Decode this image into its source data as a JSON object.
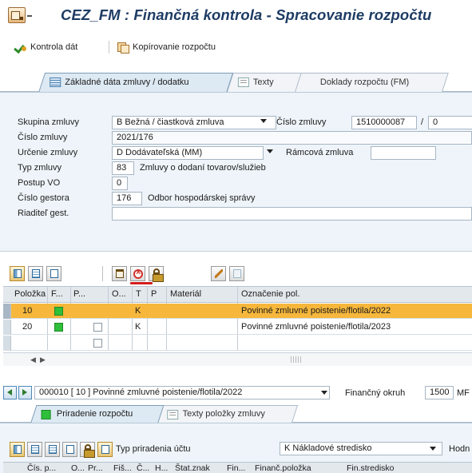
{
  "window": {
    "title": "CEZ_FM : Finančná kontrola  -  Spracovanie rozpočtu"
  },
  "toolbar": {
    "check_label": "Kontrola dát",
    "copy_label": "Kopírovanie rozpočtu"
  },
  "tabs": [
    {
      "label": "Základné dáta zmluvy / dodatku",
      "icon": "form-icon",
      "active": true
    },
    {
      "label": "Texty",
      "icon": "text-icon",
      "active": false
    },
    {
      "label": "Doklady rozpočtu (FM)",
      "icon": "",
      "active": false
    }
  ],
  "header": {
    "skupina_label": "Skupina zmluvy",
    "skupina_value": "B Bežná / čiastková zmluva",
    "cislo_zmluvy_label_right": "Číslo zmluvy",
    "cislo_zmluvy_number": "1510000087",
    "slash": "/",
    "cislo_zmluvy_version": "0",
    "cislo_label": "Číslo zmluvy",
    "cislo_value": "2021/176",
    "urcenie_label": "Určenie zmluvy",
    "urcenie_value": "D Dodávateľská (MM)",
    "ramcova_label": "Rámcová zmluva",
    "ramcova_value": "",
    "typ_label": "Typ zmluvy",
    "typ_code": "83",
    "typ_text": "Zmluvy o dodaní tovarov/služieb",
    "postup_label": "Postup VO",
    "postup_value": "0",
    "gestor_label": "Číslo gestora",
    "gestor_code": "176",
    "gestor_text": "Odbor hospodárskej správy",
    "riaditel_label": "Riaditeľ gest.",
    "riaditel_value": ""
  },
  "table": {
    "columns": [
      "Položka",
      "F...",
      "P...",
      "O...",
      "T",
      "P",
      "Materiál",
      "Označenie pol."
    ],
    "rows": [
      {
        "polozka": "10",
        "t": "K",
        "oznacenie": "Povinné zmluvné poistenie/flotila/2022",
        "selected": true
      },
      {
        "polozka": "20",
        "t": "K",
        "oznacenie": "Povinné zmluvné poistenie/flotila/2023",
        "selected": false
      }
    ]
  },
  "item_selector": {
    "value": "000010 [ 10 ] Povinné zmluvné poistenie/flotila/2022",
    "fin_okruh_label": "Finančný okruh",
    "fin_okruh_value": "1500",
    "fin_okruh_suffix": "MF"
  },
  "lower_tabs": [
    {
      "label": "Priradenie rozpočtu",
      "active": true
    },
    {
      "label": "Texty položky zmluvy",
      "active": false
    }
  ],
  "lower": {
    "typ_priradenia_label": "Typ priradenia účtu",
    "typ_priradenia_value": "K Nákladové stredisko",
    "hodn_label": "Hodn",
    "columns": [
      "Čís. p...",
      "O...",
      "Pr...",
      "Fiš...",
      "Č...",
      "H...",
      "Štat.znak",
      "Fin...",
      "Finanč.položka",
      "Fin.stredisko"
    ]
  },
  "colors": {
    "title": "#1e3c64",
    "panel": "#eef4f9",
    "selected_row": "#f6b73c",
    "status_green": "#2fbf3a",
    "highlight_red": "#d31d1d"
  }
}
